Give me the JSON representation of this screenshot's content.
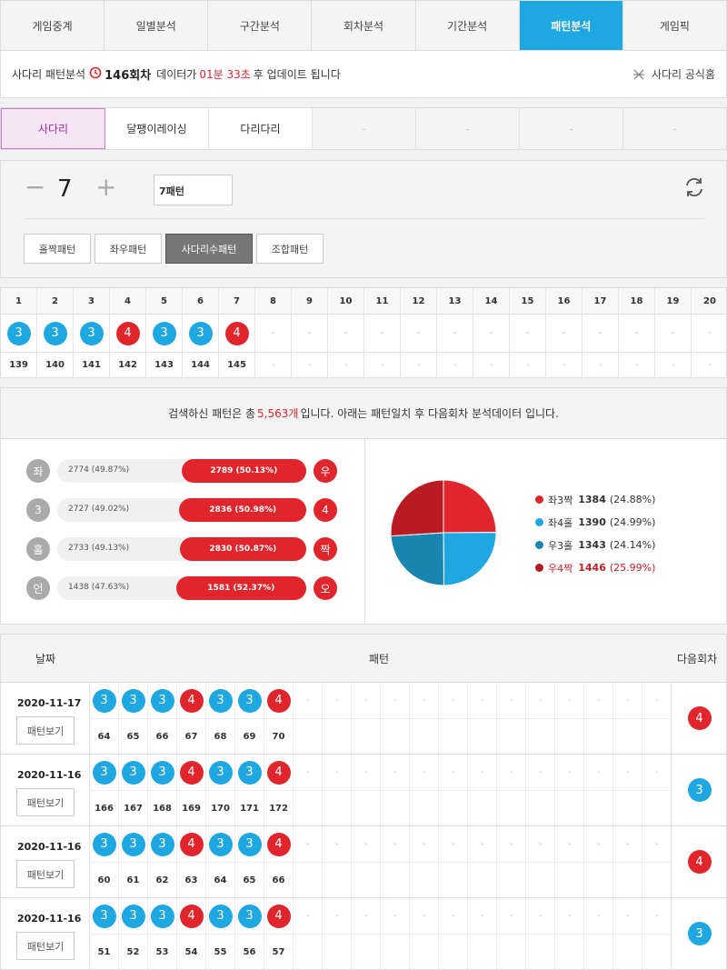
{
  "topnav": [
    "게임중계",
    "일별분석",
    "구간분석",
    "회차분석",
    "기간분석",
    "패턴분석",
    "게임픽"
  ],
  "topnav_active": 5,
  "info": {
    "label": "사다리 패턴분석",
    "round": "146회차",
    "mid": "데이터가",
    "time": "01분 33초",
    "tail": "후 업데이트 됩니다",
    "home": "사다리 공식홈"
  },
  "subtabs": [
    "사다리",
    "달팽이레이싱",
    "다리다리",
    "-",
    "-",
    "-",
    "-"
  ],
  "control": {
    "minus": "−",
    "count": "7",
    "plus": "+",
    "pattern_input": "7패턴",
    "buttons": [
      "홀짝패턴",
      "좌우패턴",
      "사다리수패턴",
      "조합패턴"
    ],
    "active_button": 2
  },
  "grid": {
    "headers": [
      "1",
      "2",
      "3",
      "4",
      "5",
      "6",
      "7",
      "8",
      "9",
      "10",
      "11",
      "12",
      "13",
      "14",
      "15",
      "16",
      "17",
      "18",
      "19",
      "20"
    ],
    "balls": [
      {
        "v": "3",
        "c": "blue"
      },
      {
        "v": "3",
        "c": "blue"
      },
      {
        "v": "3",
        "c": "blue"
      },
      {
        "v": "4",
        "c": "red"
      },
      {
        "v": "3",
        "c": "blue"
      },
      {
        "v": "3",
        "c": "blue"
      },
      {
        "v": "4",
        "c": "red"
      }
    ],
    "rounds": [
      "139",
      "140",
      "141",
      "142",
      "143",
      "144",
      "145"
    ],
    "dash": "-"
  },
  "summary": {
    "pre": "검색하신 패턴은 총",
    "count": "5,563개",
    "post": "입니다. 아래는 패턴일치 후 다음회차 분석데이터 입니다."
  },
  "bars": [
    {
      "left_label": "좌",
      "left_text": "2774 (49.87%)",
      "right_text": "2789 (50.13%)",
      "right_label": "우",
      "right_pct": 50.13
    },
    {
      "left_label": "3",
      "left_text": "2727 (49.02%)",
      "right_text": "2836 (50.98%)",
      "right_label": "4",
      "right_pct": 50.98
    },
    {
      "left_label": "홀",
      "left_text": "2733 (49.13%)",
      "right_text": "2830 (50.87%)",
      "right_label": "짝",
      "right_pct": 50.87
    },
    {
      "left_label": "언",
      "left_text": "1438 (47.63%)",
      "right_text": "1581 (52.37%)",
      "right_label": "오",
      "right_pct": 52.37
    }
  ],
  "chart_data": {
    "type": "pie",
    "slices": [
      {
        "name": "좌3짝",
        "count": 1384,
        "pct": "(24.88%)",
        "value": 24.88,
        "color": "#e0262c"
      },
      {
        "name": "좌4홀",
        "count": 1390,
        "pct": "(24.99%)",
        "value": 24.99,
        "color": "#1fa7e1"
      },
      {
        "name": "우3홀",
        "count": 1343,
        "pct": "(24.14%)",
        "value": 24.14,
        "color": "#1a86b0"
      },
      {
        "name": "우4짝",
        "count": 1446,
        "pct": "(25.99%)",
        "value": 25.99,
        "color": "#b81c22"
      }
    ]
  },
  "list_header": {
    "date": "날짜",
    "pattern": "패턴",
    "next": "다음회차"
  },
  "list": [
    {
      "date": "2020-11-17",
      "button": "패턴보기",
      "balls": [
        "3",
        "3",
        "3",
        "4",
        "3",
        "3",
        "4"
      ],
      "rounds": [
        "64",
        "65",
        "66",
        "67",
        "68",
        "69",
        "70"
      ],
      "next": "4"
    },
    {
      "date": "2020-11-16",
      "button": "패턴보기",
      "balls": [
        "3",
        "3",
        "3",
        "4",
        "3",
        "3",
        "4"
      ],
      "rounds": [
        "166",
        "167",
        "168",
        "169",
        "170",
        "171",
        "172"
      ],
      "next": "3"
    },
    {
      "date": "2020-11-16",
      "button": "패턴보기",
      "balls": [
        "3",
        "3",
        "3",
        "4",
        "3",
        "3",
        "4"
      ],
      "rounds": [
        "60",
        "61",
        "62",
        "63",
        "64",
        "65",
        "66"
      ],
      "next": "4"
    },
    {
      "date": "2020-11-16",
      "button": "패턴보기",
      "balls": [
        "3",
        "3",
        "3",
        "4",
        "3",
        "3",
        "4"
      ],
      "rounds": [
        "51",
        "52",
        "53",
        "54",
        "55",
        "56",
        "57"
      ],
      "next": "3"
    }
  ]
}
